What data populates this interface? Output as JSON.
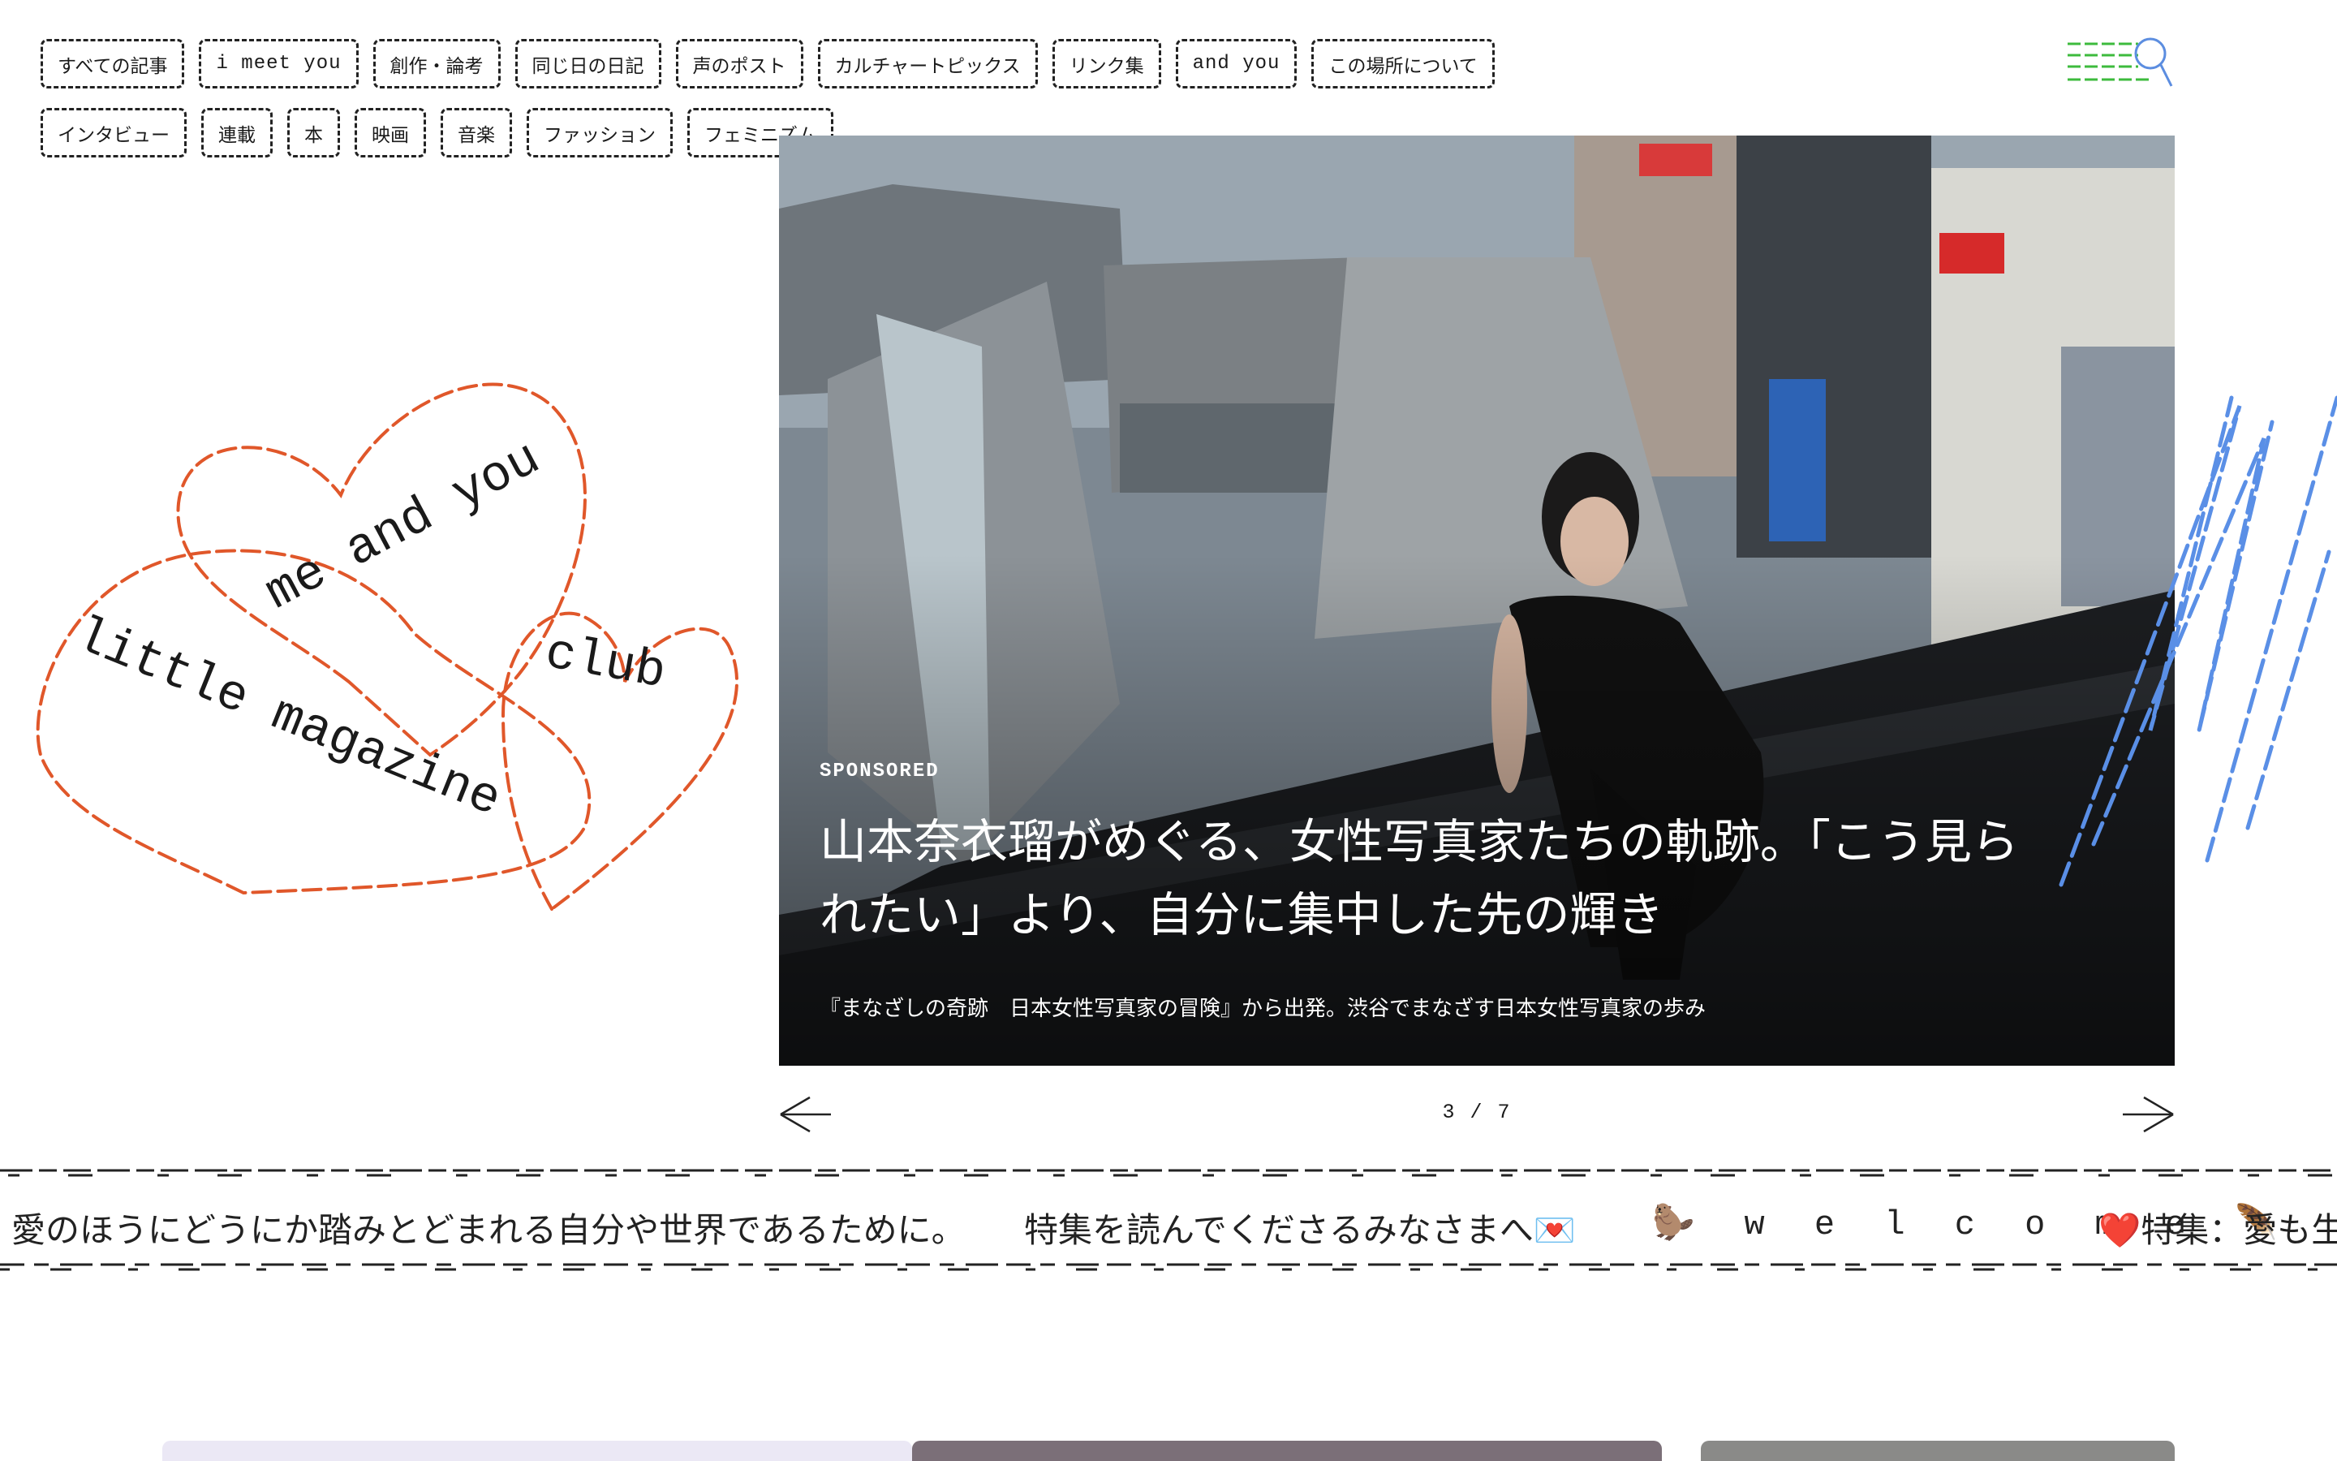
{
  "nav": {
    "row1": [
      "すべての記事",
      "i meet you",
      "創作・論考",
      "同じ日の日記",
      "声のポスト",
      "カルチャートピックス",
      "リンク集",
      "and you",
      "この場所について"
    ],
    "row2": [
      "インタビュー",
      "連載",
      "本",
      "映画",
      "音楽",
      "ファッション",
      "フェミニズム"
    ]
  },
  "logo": {
    "line1": "me and you",
    "line2": "little magazine",
    "line3": "club"
  },
  "hero": {
    "label": "SPONSORED",
    "title_line1": "山本奈衣瑠がめぐる、女性写真家たちの軌跡。「こう見ら",
    "title_line2": "れたい」より、自分に集中した先の輝き",
    "subtitle": "『まなざしの奇跡　日本女性写真家の冒険』から出発。渋谷でまなざす日本女性写真家の歩み"
  },
  "carousel": {
    "counter": "3 / 7",
    "current": 3,
    "total": 7
  },
  "ticker": {
    "items": [
      "愛のほうにどうにか踏みとどまれる自分や世界であるために。",
      "特集を読んでくださるみなさまへ💌",
      "🦫 w e l c o m e 🪶",
      "❤️特集：愛も生"
    ]
  },
  "colors": {
    "logo_orange": "#e0572a",
    "menu_green": "#3dbb3d",
    "search_blue": "#5b8de0",
    "scribble_blue": "#5a8fe6"
  },
  "icons": {
    "menu": "menu-lines-icon",
    "search": "search-icon",
    "prev": "arrow-left-icon",
    "next": "arrow-right-icon"
  }
}
